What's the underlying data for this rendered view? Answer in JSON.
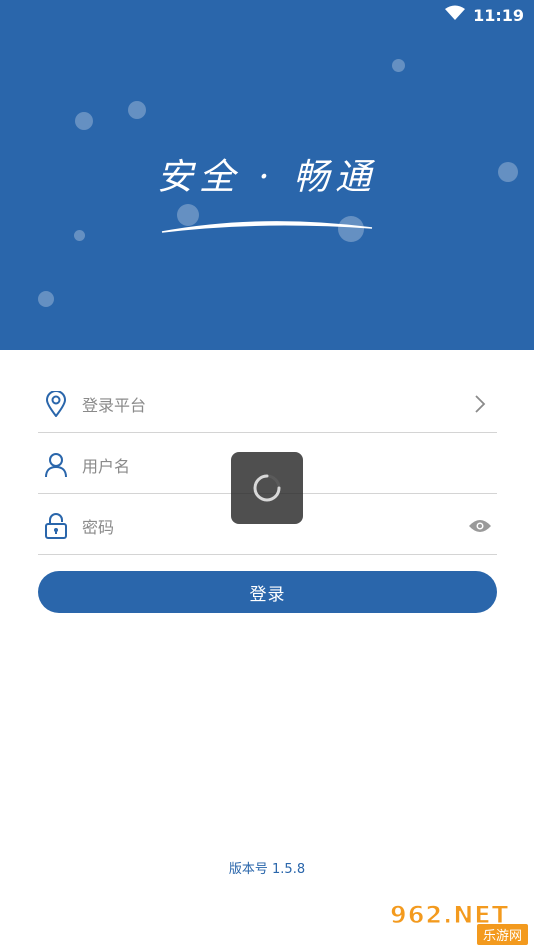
{
  "status_bar": {
    "time": "11:19"
  },
  "header": {
    "slogan": "安全 · 畅通"
  },
  "form": {
    "platform_label": "登录平台",
    "username_placeholder": "用户名",
    "password_placeholder": "密码",
    "login_button": "登录"
  },
  "footer": {
    "version": "版本号 1.5.8"
  },
  "watermark": {
    "logo_text": "962.NET",
    "site_name": "乐游网"
  },
  "colors": {
    "brand_blue": "#2a66ab",
    "divider": "#d4d4d4",
    "placeholder": "#8a8a8a"
  }
}
